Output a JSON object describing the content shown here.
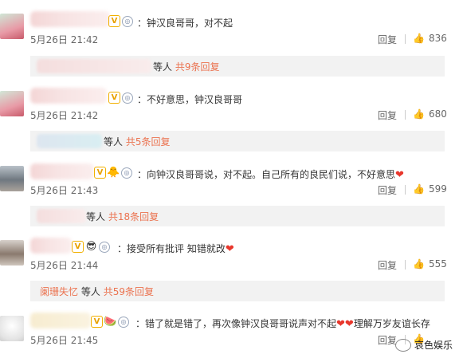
{
  "comments": [
    {
      "text": "：钟汉良哥哥，对不起",
      "time": "5月26日 21:42",
      "reply": "回复",
      "likes": "836"
    },
    {
      "text": "：不好意思，钟汉良哥哥",
      "time": "5月26日 21:42",
      "reply": "回复",
      "likes": "680"
    },
    {
      "text": "：向钟汉良哥哥说，对不起。自己所有的良民们说，不好意思",
      "time": "5月26日 21:43",
      "reply": "回复",
      "likes": "599"
    },
    {
      "text": "：接受所有批评 知错就改",
      "time": "5月26日 21:44",
      "reply": "回复",
      "likes": "555"
    },
    {
      "text": "：错了就是错了，再次像钟汉良哥哥说声对不起",
      "text2": "理解万岁友谊长存",
      "time": "5月26日 21:45",
      "reply": "回复",
      "likes": ""
    }
  ],
  "reply_bars": [
    {
      "suffix": "等人",
      "count": "共9条回复"
    },
    {
      "suffix": "等人",
      "count": "共5条回复"
    },
    {
      "suffix": "等人",
      "count": "共18条回复"
    },
    {
      "named_user": "阑珊失忆",
      "suffix": "等人",
      "count": "共59条回复"
    }
  ],
  "watermark": {
    "text": "哀色娱乐"
  },
  "icons": {
    "like": "thumbs-up-icon",
    "heart": "heart-emoji",
    "badge": "rank-badge-icon"
  },
  "colors": {
    "accent": "#eb7350",
    "heart": "#e8372c",
    "reply_bg": "#f2f2f2"
  }
}
